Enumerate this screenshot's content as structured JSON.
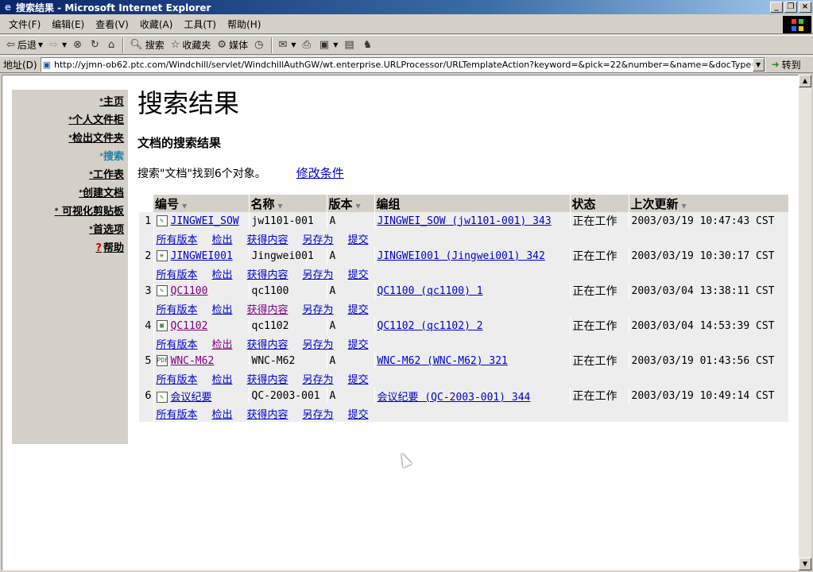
{
  "window": {
    "title": "搜索结果 - Microsoft Internet Explorer",
    "min": "_",
    "max": "❐",
    "close": "×"
  },
  "menu": [
    "文件(F)",
    "编辑(E)",
    "查看(V)",
    "收藏(A)",
    "工具(T)",
    "帮助(H)"
  ],
  "toolbar": {
    "back": "后退",
    "search": "搜索",
    "favorites": "收藏夹",
    "media": "媒体"
  },
  "address": {
    "label": "地址(D)",
    "url": "http://yjmn-ob62.ptc.com/Windchill/servlet/WindchillAuthGW/wt.enterprise.URLProcessor/URLTemplateAction?keyword=&pick=22&number=&name=&docType=&versionIdentifier=&",
    "go": "转到"
  },
  "nav": {
    "items": [
      {
        "label": "主页"
      },
      {
        "label": "个人文件柜"
      },
      {
        "label": "检出文件夹"
      },
      {
        "label": "搜索"
      },
      {
        "label": "工作表"
      },
      {
        "label": "创建文档"
      },
      {
        "label": "可视化剪贴板"
      },
      {
        "label": "首选项"
      },
      {
        "label": "帮助"
      }
    ]
  },
  "main": {
    "title": "搜索结果",
    "subtitle": "文档的搜索结果",
    "found": "搜索\"文档\"找到6个对象。",
    "modify": "修改条件"
  },
  "table": {
    "headers": [
      "编号",
      "名称",
      "版本",
      "编组",
      "状态",
      "上次更新"
    ],
    "action_labels": [
      "所有版本",
      "检出",
      "获得内容",
      "另存为",
      "提交"
    ],
    "rows": [
      {
        "n": "1",
        "number": "JINGWEI_SOW",
        "name": "jw1101-001",
        "version": "A",
        "group": "JINGWEI_SOW (jw1101-001) 343",
        "status": "正在工作",
        "updated": "2003/03/19 10:47:43 CST"
      },
      {
        "n": "2",
        "number": "JINGWEI001",
        "name": "Jingwei001",
        "version": "A",
        "group": "JINGWEI001 (Jingwei001) 342",
        "status": "正在工作",
        "updated": "2003/03/19 10:30:17 CST"
      },
      {
        "n": "3",
        "number": "QC1100",
        "name": "qc1100",
        "version": "A",
        "group": "QC1100 (qc1100) 1",
        "status": "正在工作",
        "updated": "2003/03/04 13:38:11 CST"
      },
      {
        "n": "4",
        "number": "QC1102",
        "name": "qc1102",
        "version": "A",
        "group": "QC1102 (qc1102) 2",
        "status": "正在工作",
        "updated": "2003/03/04 14:53:39 CST"
      },
      {
        "n": "5",
        "number": "WNC-M62",
        "name": "WNC-M62",
        "version": "A",
        "group": "WNC-M62 (WNC-M62) 321",
        "status": "正在工作",
        "updated": "2003/03/19 01:43:56 CST"
      },
      {
        "n": "6",
        "number": "会议纪要",
        "name": "QC-2003-001",
        "version": "A",
        "group": "会议纪要 (QC-2003-001) 344",
        "status": "正在工作",
        "updated": "2003/03/19 10:49:14 CST"
      }
    ]
  },
  "colors": {
    "link": "#0000cc",
    "visited": "#800080",
    "active_nav": "#1d7fa8"
  }
}
